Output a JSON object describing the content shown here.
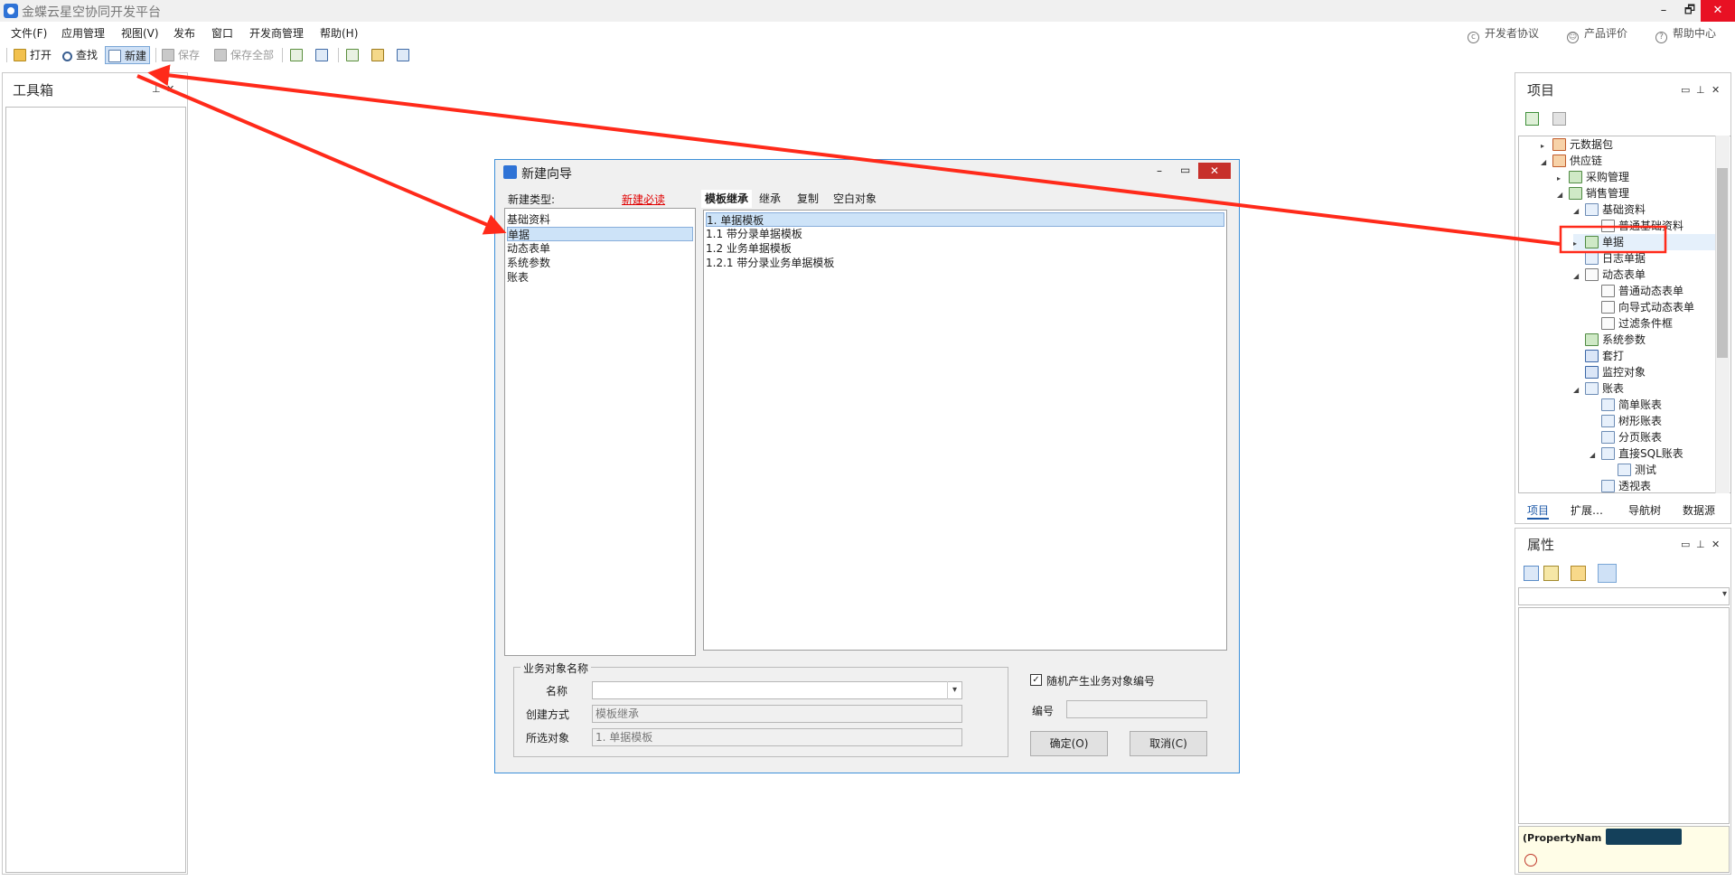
{
  "window": {
    "title": "金蝶云星空协同开发平台",
    "min": "–",
    "restore": "🗗",
    "close": "✕"
  },
  "menu": {
    "items": [
      "文件(F)",
      "应用管理",
      "视图(V)",
      "发布",
      "窗口",
      "开发商管理",
      "帮助(H)"
    ],
    "right_links": [
      "开发者协议",
      "产品评价",
      "帮助中心"
    ]
  },
  "toolbar": {
    "open": "打开",
    "find": "查找",
    "new": "新建",
    "save": "保存",
    "save_all": "保存全部"
  },
  "toolbox": {
    "title": "工具箱"
  },
  "project": {
    "title": "项目",
    "tree": [
      {
        "label": "元数据包",
        "expander": "▸",
        "icon": "package-icon"
      },
      {
        "label": "供应链",
        "expander": "◢",
        "icon": "package-icon"
      },
      {
        "label": "采购管理",
        "expander": "▸",
        "icon": "module-icon"
      },
      {
        "label": "销售管理",
        "expander": "◢",
        "icon": "module-icon"
      },
      {
        "label": "基础资料",
        "expander": "◢",
        "icon": "basedata-icon"
      },
      {
        "label": "普通基础资料",
        "expander": "",
        "icon": "form-icon"
      },
      {
        "label": "单据",
        "expander": "▸",
        "icon": "bill-icon"
      },
      {
        "label": "日志单据",
        "expander": "",
        "icon": "bill-icon"
      },
      {
        "label": "动态表单",
        "expander": "◢",
        "icon": "dynamic-form-icon"
      },
      {
        "label": "普通动态表单",
        "expander": "",
        "icon": "form-icon"
      },
      {
        "label": "向导式动态表单",
        "expander": "",
        "icon": "form-icon"
      },
      {
        "label": "过滤条件框",
        "expander": "",
        "icon": "form-icon"
      },
      {
        "label": "系统参数",
        "expander": "",
        "icon": "parameter-icon"
      },
      {
        "label": "套打",
        "expander": "",
        "icon": "print-icon"
      },
      {
        "label": "监控对象",
        "expander": "",
        "icon": "monitor-icon"
      },
      {
        "label": "账表",
        "expander": "◢",
        "icon": "report-icon"
      },
      {
        "label": "简单账表",
        "expander": "",
        "icon": "report-icon"
      },
      {
        "label": "树形账表",
        "expander": "",
        "icon": "report-icon"
      },
      {
        "label": "分页账表",
        "expander": "",
        "icon": "report-icon"
      },
      {
        "label": "直接SQL账表",
        "expander": "◢",
        "icon": "report-icon"
      },
      {
        "label": "测试",
        "expander": "",
        "icon": "report-icon"
      },
      {
        "label": "透视表",
        "expander": "",
        "icon": "report-icon"
      }
    ],
    "tabs": [
      "项目",
      "扩展…",
      "导航树",
      "数据源"
    ]
  },
  "properties": {
    "title": "属性",
    "desc_label": "(PropertyNam"
  },
  "dialog": {
    "title": "新建向导",
    "type_label": "新建类型:",
    "must_read": "新建必读",
    "types": [
      "基础资料",
      "单据",
      "动态表单",
      "系统参数",
      "账表"
    ],
    "selected_type": 1,
    "tabs": [
      "模板继承",
      "继承",
      "复制",
      "空白对象"
    ],
    "templates": [
      "1. 单据模板",
      "1.1 带分录单据模板",
      "1.2 业务单据模板",
      "1.2.1 带分录业务单据模板"
    ],
    "selected_template": 0,
    "group_title": "业务对象名称",
    "name_label": "名称",
    "name_value": "",
    "create_mode_label": "创建方式",
    "create_mode_value": "模板继承",
    "selected_object_label": "所选对象",
    "selected_object_value": "1. 单据模板",
    "random_number_label": "随机产生业务对象编号",
    "random_number_checked": true,
    "number_label": "编号",
    "number_value": "",
    "ok_button": "确定(O)",
    "cancel_button": "取消(C)"
  },
  "colors": {
    "accent": "#3c8fd8",
    "annotation_red": "#ff2a1a",
    "link_red": "#e00000",
    "selection": "#cde3f8"
  }
}
